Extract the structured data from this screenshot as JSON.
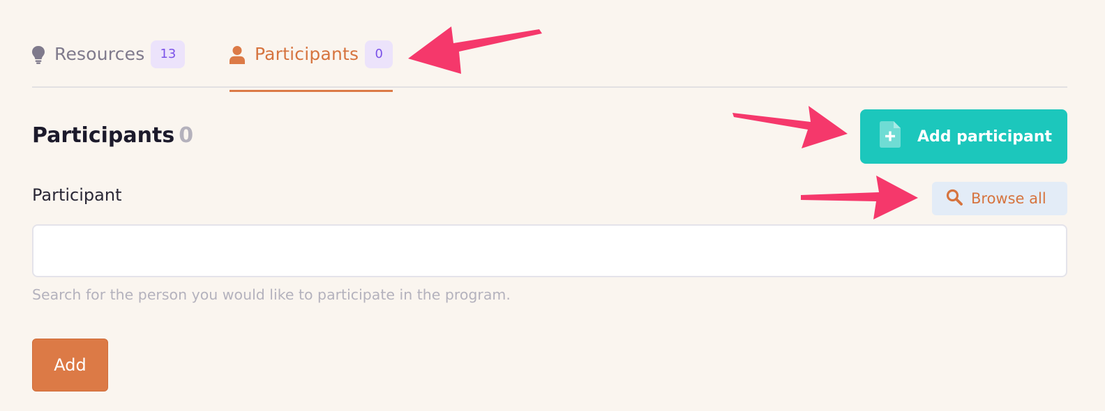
{
  "tabs": {
    "resources": {
      "label": "Resources",
      "count": "13",
      "icon": "lightbulb-icon"
    },
    "participants": {
      "label": "Participants",
      "count": "0",
      "icon": "person-icon",
      "active": true
    }
  },
  "section": {
    "title": "Participants",
    "count": "0"
  },
  "actions": {
    "add_participant_label": "Add participant",
    "add_participant_icon": "file-plus-icon",
    "browse_all_label": "Browse all",
    "browse_all_icon": "search-icon"
  },
  "field": {
    "label": "Participant",
    "value": "",
    "placeholder": "",
    "help": "Search for the person you would like to participate in the program."
  },
  "submit_label": "Add",
  "colors": {
    "background": "#faf5ef",
    "accent_orange": "#dc7a46",
    "teal": "#1cc7bc",
    "badge_bg": "#ece3fb",
    "badge_text": "#7b52e8",
    "annotation_arrow": "#f5386b"
  }
}
